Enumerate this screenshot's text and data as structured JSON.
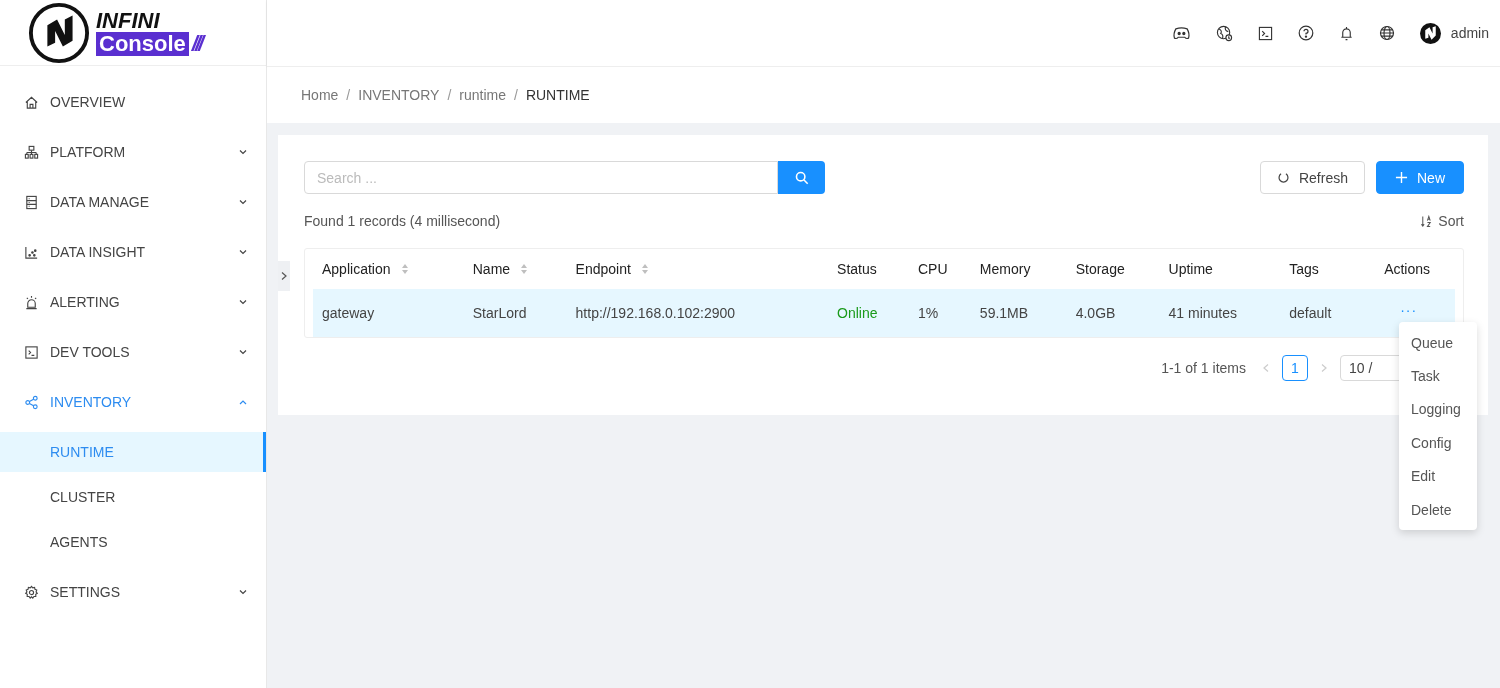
{
  "logo": {
    "line1": "INFINI",
    "line2": "Console",
    "slashes": "///"
  },
  "header": {
    "user": "admin"
  },
  "sidebar": {
    "items": [
      {
        "label": "OVERVIEW",
        "selected": false
      },
      {
        "label": "PLATFORM",
        "selected": false,
        "expanded": false
      },
      {
        "label": "DATA MANAGE",
        "selected": false,
        "expanded": false
      },
      {
        "label": "DATA INSIGHT",
        "selected": false,
        "expanded": false
      },
      {
        "label": "ALERTING",
        "selected": false,
        "expanded": false
      },
      {
        "label": "DEV TOOLS",
        "selected": false,
        "expanded": false
      },
      {
        "label": "INVENTORY",
        "selected": true,
        "expanded": true,
        "children": [
          {
            "label": "RUNTIME",
            "selected": true
          },
          {
            "label": "CLUSTER",
            "selected": false
          },
          {
            "label": "AGENTS",
            "selected": false
          }
        ]
      },
      {
        "label": "SETTINGS",
        "selected": false,
        "expanded": false
      }
    ]
  },
  "breadcrumb": [
    {
      "label": "Home"
    },
    {
      "separator": "/",
      "label": "INVENTORY"
    },
    {
      "separator": "/",
      "label": "runtime"
    },
    {
      "separator": "/",
      "label": "RUNTIME"
    }
  ],
  "toolbar": {
    "search": {
      "placeholder": "Search ..."
    },
    "refresh": "Refresh",
    "new": "New",
    "sort": "Sort"
  },
  "summary": "Found 1 records (4 millisecond)",
  "table": {
    "columns": [
      {
        "label": "Application",
        "sortable": true,
        "kind": "text"
      },
      {
        "label": "Name",
        "sortable": true,
        "kind": "text"
      },
      {
        "label": "Endpoint",
        "sortable": true,
        "kind": "text"
      },
      {
        "label": "Status",
        "sortable": false,
        "kind": "status"
      },
      {
        "label": "CPU",
        "sortable": false,
        "kind": "text"
      },
      {
        "label": "Memory",
        "sortable": false,
        "kind": "text"
      },
      {
        "label": "Storage",
        "sortable": false,
        "kind": "text"
      },
      {
        "label": "Uptime",
        "sortable": false,
        "kind": "text"
      },
      {
        "label": "Tags",
        "sortable": false,
        "kind": "text"
      },
      {
        "label": "Actions",
        "sortable": false,
        "kind": "actions"
      }
    ],
    "rows": [
      {
        "selected": true,
        "cells": [
          "gateway",
          "StarLord",
          "http://192.168.0.102:2900",
          "Online",
          "1%",
          "59.1MB",
          "4.0GB",
          "41 minutes",
          "default",
          "···"
        ]
      }
    ]
  },
  "pagination": {
    "range": "1-1 of 1 items",
    "pages": [
      {
        "label": "1",
        "selected": true
      }
    ],
    "page_size": "10 /"
  },
  "action_menu": [
    "Queue",
    "Task",
    "Logging",
    "Config",
    "Edit",
    "Delete"
  ]
}
